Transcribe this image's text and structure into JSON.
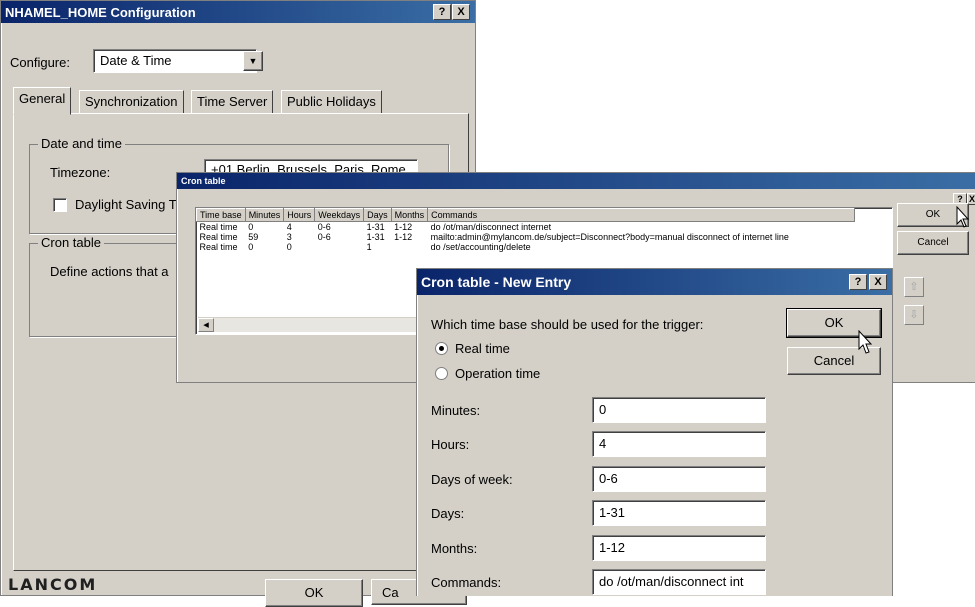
{
  "config_window": {
    "title": "NHAMEL_HOME Configuration",
    "help_btn": "?",
    "close_btn": "X",
    "configure_label": "Configure:",
    "configure_value": "Date & Time",
    "tabs": [
      {
        "label": "General"
      },
      {
        "label": "Synchronization"
      },
      {
        "label": "Time Server"
      },
      {
        "label": "Public Holidays"
      }
    ],
    "date_time_group": "Date and time",
    "timezone_label": "Timezone:",
    "timezone_value": "+01 Berlin, Brussels, Paris, Rome",
    "dst_label": "Daylight Saving T",
    "cron_group": "Cron table",
    "cron_desc": "Define actions that a",
    "logo": "LANCOM",
    "ok_btn": "OK",
    "cancel_btn": "Ca"
  },
  "cron_window": {
    "title": "Cron table",
    "help_btn": "?",
    "close_btn": "X",
    "columns": [
      "Time base",
      "Minutes",
      "Hours",
      "Weekdays",
      "Days",
      "Months",
      "Commands"
    ],
    "rows": [
      {
        "c0": "Real time",
        "c1": "0",
        "c2": "4",
        "c3": "0-6",
        "c4": "1-31",
        "c5": "1-12",
        "c6": "do /ot/man/disconnect internet"
      },
      {
        "c0": "Real time",
        "c1": "59",
        "c2": "3",
        "c3": "0-6",
        "c4": "1-31",
        "c5": "1-12",
        "c6": "mailto:admin@mylancom.de/subject=Disconnect?body=manual disconnect of internet line"
      },
      {
        "c0": "Real time",
        "c1": "0",
        "c2": "0",
        "c3": "",
        "c4": "1",
        "c5": "",
        "c6": "do /set/accounting/delete"
      }
    ],
    "ok_btn": "OK",
    "cancel_btn": "Cancel",
    "scroll_left": "◂",
    "move_up": "⇧",
    "move_down": "⇩"
  },
  "new_entry": {
    "title": "Cron table - New Entry",
    "help_btn": "?",
    "close_btn": "X",
    "question": "Which time base should be used for the trigger:",
    "radio_realtime": "Real time",
    "radio_optime": "Operation time",
    "ok_btn": "OK",
    "cancel_btn": "Cancel",
    "fields": [
      {
        "label": "Minutes:",
        "value": "0"
      },
      {
        "label": "Hours:",
        "value": "4"
      },
      {
        "label": "Days of week:",
        "value": "0-6"
      },
      {
        "label": "Days:",
        "value": "1-31"
      },
      {
        "label": "Months:",
        "value": "1-12"
      },
      {
        "label": "Commands:",
        "value": "do /ot/man/disconnect int"
      }
    ]
  }
}
